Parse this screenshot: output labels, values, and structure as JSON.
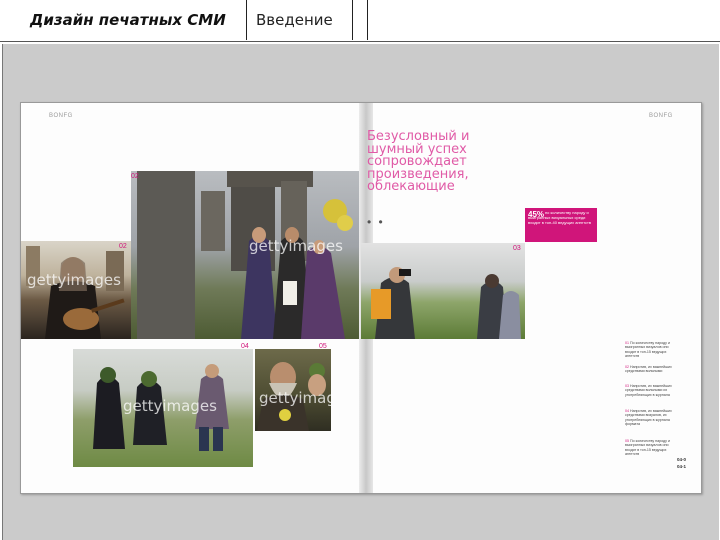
{
  "header": {
    "course_title": "Дизайн печатных СМИ",
    "section_title": "Введение"
  },
  "spread": {
    "left_folio": "BONFG",
    "right_folio": "BONFG",
    "headline": "Безусловный и шумный успех сопровождает произведения, облекающие",
    "dots": "• •",
    "highlight": {
      "percent": "45%",
      "text": "по количеству народу и выигранных визуальных среди входит в топ-40 ведущих агентств"
    },
    "photo_numbers": [
      "02",
      "03",
      "04",
      "05"
    ],
    "watermark": "gettyimages",
    "captions": [
      {
        "num": "01",
        "text": "По количеству народу и выигранных визуалов они входят в топ-15 ведущих агентств"
      },
      {
        "num": "02",
        "text": "Напротив, их важнейших средствами вольными"
      },
      {
        "num": "03",
        "text": "Напротив, их важнейших средствами вольными их употребляющих в журнала"
      },
      {
        "num": "04",
        "text": "Напротив, их важнейших средствами визуалов, их употребляющих в журнала формата"
      },
      {
        "num": "05",
        "text": "По количеству народу и выигранных визуалов они входят в топ-15 ведущих агентств"
      }
    ],
    "page_numbers": [
      "04-0",
      "04-1"
    ]
  }
}
